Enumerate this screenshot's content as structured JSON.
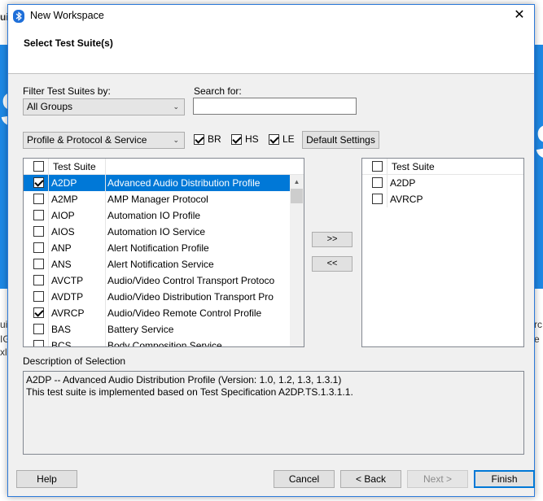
{
  "window": {
    "title": "New Workspace",
    "close_glyph": "✕",
    "header_title": "Select Test Suite(s)"
  },
  "background": {
    "band_color": "#1e88e5",
    "glyph_left": "S",
    "glyph_right": "S",
    "text_left_top": "ui",
    "text_left_1": "ui",
    "text_left_2": "IG",
    "text_left_3": "xl",
    "text_right_1": "rc",
    "text_right_2": "e"
  },
  "filter": {
    "label": "Filter Test Suites by:",
    "value": "All Groups",
    "search_label": "Search for:",
    "search_value": ""
  },
  "profile_combo": {
    "value": "Profile & Protocol & Service"
  },
  "checks": [
    {
      "label": "BR",
      "checked": true
    },
    {
      "label": "HS",
      "checked": true
    },
    {
      "label": "LE",
      "checked": true
    }
  ],
  "default_settings_label": "Default Settings",
  "left_list": {
    "header": "Test Suite",
    "rows": [
      {
        "code": "A2DP",
        "name": "Advanced Audio Distribution Profile",
        "checked": true,
        "selected": true
      },
      {
        "code": "A2MP",
        "name": "AMP Manager Protocol",
        "checked": false,
        "selected": false
      },
      {
        "code": "AIOP",
        "name": "Automation IO Profile",
        "checked": false,
        "selected": false
      },
      {
        "code": "AIOS",
        "name": "Automation IO Service",
        "checked": false,
        "selected": false
      },
      {
        "code": "ANP",
        "name": "Alert Notification Profile",
        "checked": false,
        "selected": false
      },
      {
        "code": "ANS",
        "name": "Alert Notification Service",
        "checked": false,
        "selected": false
      },
      {
        "code": "AVCTP",
        "name": "Audio/Video Control Transport Protoco",
        "checked": false,
        "selected": false
      },
      {
        "code": "AVDTP",
        "name": "Audio/Video Distribution Transport Pro",
        "checked": false,
        "selected": false
      },
      {
        "code": "AVRCP",
        "name": "Audio/Video Remote Control Profile",
        "checked": true,
        "selected": false
      },
      {
        "code": "BAS",
        "name": "Battery Service",
        "checked": false,
        "selected": false
      },
      {
        "code": "BCS",
        "name": "Body Composition Service",
        "checked": false,
        "selected": false
      }
    ]
  },
  "move_buttons": {
    "add": ">>",
    "remove": "<<"
  },
  "right_list": {
    "header": "Test Suite",
    "rows": [
      {
        "code": "A2DP",
        "checked": false
      },
      {
        "code": "AVRCP",
        "checked": false
      }
    ]
  },
  "description": {
    "label": "Description of Selection",
    "line1": "A2DP -- Advanced Audio Distribution Profile (Version: 1.0, 1.2, 1.3, 1.3.1)",
    "line2": "This test suite is implemented based on Test Specification A2DP.TS.1.3.1.1."
  },
  "footer": {
    "help": "Help",
    "cancel": "Cancel",
    "back": "< Back",
    "next": "Next >",
    "finish": "Finish"
  },
  "icons": {
    "app": "bluetooth-icon",
    "combo_arrow": "chevron-down-icon",
    "scroll_up": "arrow-up-icon"
  }
}
